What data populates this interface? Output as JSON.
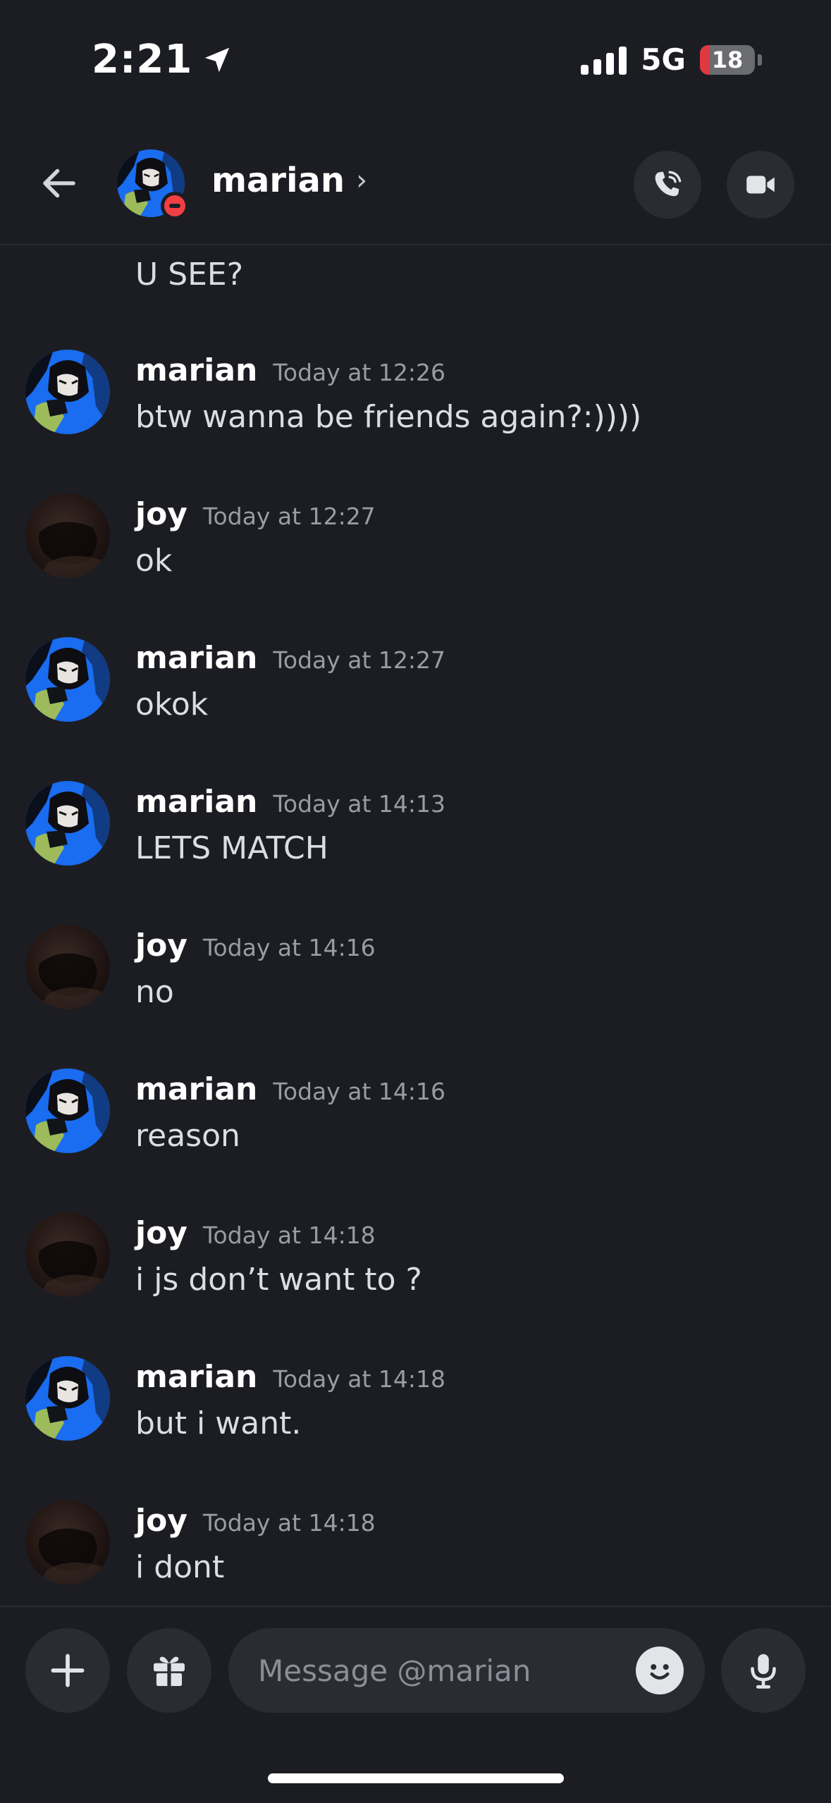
{
  "status_bar": {
    "time": "2:21",
    "network": "5G",
    "battery": "18",
    "battery_level": 0.18,
    "icons": [
      "location-arrow-icon",
      "cellular-signal-icon",
      "battery-icon"
    ]
  },
  "header": {
    "name": "marian",
    "chevron": "›",
    "status": "do-not-disturb",
    "icons": [
      "back-arrow-icon",
      "voice-call-icon",
      "video-call-icon"
    ]
  },
  "messages": {
    "continuation": "U SEE?",
    "items": [
      {
        "author": "marian",
        "time": "Today at 12:26",
        "text": "btw wanna be friends again?:))))"
      },
      {
        "author": "joy",
        "time": "Today at 12:27",
        "text": "ok"
      },
      {
        "author": "marian",
        "time": "Today at 12:27",
        "text": "okok"
      },
      {
        "author": "marian",
        "time": "Today at 14:13",
        "text": "LETS MATCH"
      },
      {
        "author": "joy",
        "time": "Today at 14:16",
        "text": "no"
      },
      {
        "author": "marian",
        "time": "Today at 14:16",
        "text": "reason"
      },
      {
        "author": "joy",
        "time": "Today at 14:18",
        "text": "i js don’t want to ?"
      },
      {
        "author": "marian",
        "time": "Today at 14:18",
        "text": "but i want."
      },
      {
        "author": "joy",
        "time": "Today at 14:18",
        "text": "i dont"
      }
    ]
  },
  "composer": {
    "placeholder": "Message @marian",
    "value": "",
    "icons": [
      "plus-icon",
      "gift-icon",
      "emoji-icon",
      "microphone-icon"
    ]
  },
  "colors": {
    "background": "#1c1d23",
    "button_bg": "#2b2c33",
    "timestamp": "#9a9ba3",
    "dnd_red": "#f23f43",
    "battery_red": "#e0383e",
    "marian_avatar_blue": "#1a6cf0"
  }
}
